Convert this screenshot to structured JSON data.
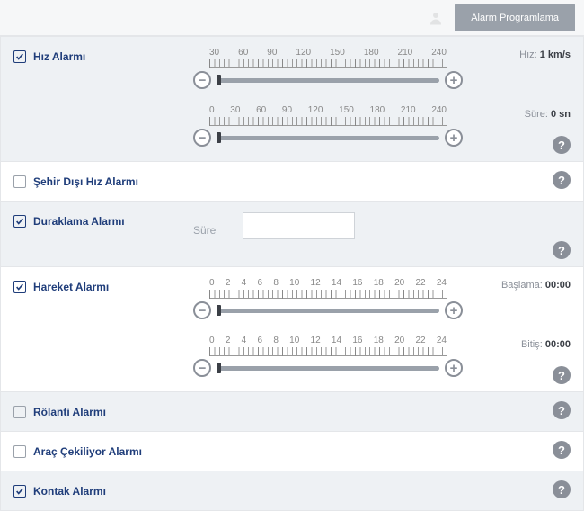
{
  "topbar": {
    "tab_label": "Alarm Programlama"
  },
  "sections": {
    "hiz": {
      "label": "Hız Alarmı",
      "checked": true,
      "slider1": {
        "ticks": [
          "30",
          "60",
          "90",
          "120",
          "150",
          "180",
          "210",
          "240"
        ],
        "right_label": "Hız:",
        "right_value": "1 km/s",
        "handle_pct": 0
      },
      "slider2": {
        "ticks": [
          "0",
          "30",
          "60",
          "90",
          "120",
          "150",
          "180",
          "210",
          "240"
        ],
        "right_label": "Süre:",
        "right_value": "0 sn",
        "handle_pct": 0
      }
    },
    "sehir_disi": {
      "label": "Şehir Dışı Hız Alarmı",
      "checked": false
    },
    "duraklama": {
      "label": "Duraklama Alarmı",
      "checked": true,
      "sure_label": "Süre",
      "sure_value": ""
    },
    "hareket": {
      "label": "Hareket Alarmı",
      "checked": true,
      "slider1": {
        "ticks": [
          "0",
          "2",
          "4",
          "6",
          "8",
          "10",
          "12",
          "14",
          "16",
          "18",
          "20",
          "22",
          "24"
        ],
        "right_label": "Başlama:",
        "right_value": "00:00",
        "handle_pct": 0
      },
      "slider2": {
        "ticks": [
          "0",
          "2",
          "4",
          "6",
          "8",
          "10",
          "12",
          "14",
          "16",
          "18",
          "20",
          "22",
          "24"
        ],
        "right_label": "Bitiş:",
        "right_value": "00:00",
        "handle_pct": 0
      }
    },
    "rolanti": {
      "label": "Rölanti Alarmı",
      "checked": false
    },
    "arac_cekiliyor": {
      "label": "Araç Çekiliyor Alarmı",
      "checked": false
    },
    "kontak": {
      "label": "Kontak Alarmı",
      "checked": true
    }
  }
}
